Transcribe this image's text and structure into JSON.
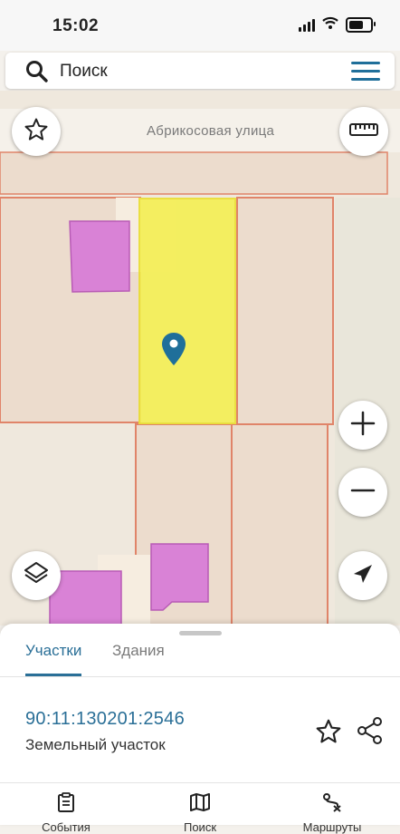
{
  "status_bar": {
    "time": "15:02",
    "icons": [
      "signal-icon",
      "wifi-icon",
      "battery-icon"
    ]
  },
  "search": {
    "placeholder": "Поиск",
    "value": "",
    "icon": "search-icon",
    "menu_icon": "menu-icon"
  },
  "map": {
    "street_label": "Абрикосовая улица",
    "controls": [
      "star-icon",
      "ruler-icon",
      "zoom-in-icon",
      "zoom-out-icon",
      "layers-icon",
      "locate-icon"
    ],
    "colors": {
      "selected_parcel": "#f4ef5a",
      "parcel_border": "#e08469",
      "building": "#d982d6",
      "pin": "#1f6f9a"
    }
  },
  "sheet": {
    "tabs": [
      {
        "label": "Участки",
        "active": true
      },
      {
        "label": "Здания",
        "active": false
      }
    ],
    "parcel": {
      "cadastral_number": "90:11:130201:2546",
      "type": "Земельный участок"
    },
    "actions": [
      "star-icon",
      "share-icon"
    ]
  },
  "bottom_nav": [
    {
      "label": "События",
      "icon": "clipboard-icon"
    },
    {
      "label": "Поиск",
      "icon": "map-icon"
    },
    {
      "label": "Маршруты",
      "icon": "route-icon"
    }
  ],
  "accent_color": "#2a6f97"
}
